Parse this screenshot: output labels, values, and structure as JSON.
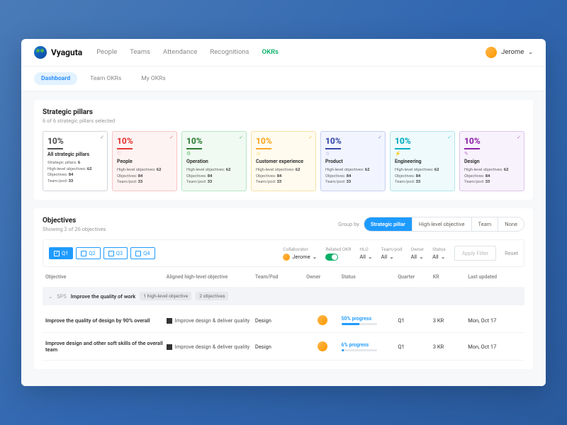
{
  "brand": "Vyaguta",
  "nav": {
    "people": "People",
    "teams": "Teams",
    "attendance": "Attendance",
    "recognitions": "Recognitions",
    "okrs": "OKRs"
  },
  "user": {
    "name": "Jerome"
  },
  "subnav": {
    "dashboard": "Dashboard",
    "team": "Team OKRs",
    "my": "My OKRs"
  },
  "pillars": {
    "title": "Strategic pillars",
    "sub": "6 of 6 strategic pillars selected",
    "stat_labels": {
      "sp": "Strategic pillars:",
      "hlo": "High-level objectives:",
      "obj": "Objectives:",
      "team": "Team/pod:"
    },
    "all": {
      "pct": "10%",
      "name": "All strategic pillars",
      "sp": "6",
      "hlo": "62",
      "obj": "84",
      "team": "33"
    },
    "items": [
      {
        "pct": "10%",
        "name": "People",
        "hlo": "62",
        "obj": "84",
        "team": "33",
        "cls": "p-people",
        "ico": "♡"
      },
      {
        "pct": "10%",
        "name": "Operation",
        "hlo": "62",
        "obj": "84",
        "team": "33",
        "cls": "p-op",
        "ico": "⚙"
      },
      {
        "pct": "10%",
        "name": "Customer experience",
        "hlo": "62",
        "obj": "84",
        "team": "33",
        "cls": "p-cx",
        "ico": "☺"
      },
      {
        "pct": "10%",
        "name": "Product",
        "hlo": "62",
        "obj": "84",
        "team": "33",
        "cls": "p-prod",
        "ico": "☆"
      },
      {
        "pct": "10%",
        "name": "Engineering",
        "hlo": "62",
        "obj": "84",
        "team": "33",
        "cls": "p-eng",
        "ico": "⚡"
      },
      {
        "pct": "10%",
        "name": "Design",
        "hlo": "62",
        "obj": "84",
        "team": "33",
        "cls": "p-des",
        "ico": "✎"
      }
    ]
  },
  "objectives": {
    "title": "Objectives",
    "sub": "Showing 2 of 26 objectives",
    "groupby_label": "Group by",
    "groupby": {
      "sp": "Strategic pillar",
      "hlo": "High-level objective",
      "team": "Team",
      "none": "None"
    },
    "quarters": {
      "q1": "Q1",
      "q2": "Q2",
      "q3": "Q3",
      "q4": "Q4"
    },
    "filters": {
      "collab_lbl": "Collaborator",
      "collab_val": "Jerome",
      "related_lbl": "Related OKR",
      "hlo_lbl": "HLO",
      "hlo_val": "All",
      "team_lbl": "Team/pod",
      "team_val": "All",
      "owner_lbl": "Owner",
      "owner_val": "All",
      "status_lbl": "Status",
      "status_val": "All",
      "apply": "Apply Filter",
      "reset": "Reset"
    },
    "cols": {
      "obj": "Objective",
      "hlo": "Aligned high-level objective",
      "team": "Team/Pod",
      "owner": "Owner",
      "status": "Status",
      "q": "Quarter",
      "kr": "KR",
      "upd": "Last updated"
    },
    "group": {
      "sp": "SP5",
      "title": "Improve the quality of work",
      "tag1": "1 high-level objective",
      "tag2": "2 objectives"
    },
    "rows": [
      {
        "title": "Improve the quality of design by 90% overall",
        "hlo": "Improve design & deliver quality",
        "team": "Design",
        "prog_txt": "50% progress",
        "prog": 50,
        "q": "Q1",
        "kr": "3 KR",
        "upd": "Mon, Oct 17"
      },
      {
        "title": "Improve design and other soft skills of the overall team",
        "hlo": "Improve design & deliver quality",
        "team": "Design",
        "prog_txt": "6% progress",
        "prog": 6,
        "q": "Q1",
        "kr": "3 KR",
        "upd": "Mon, Oct 17"
      }
    ]
  }
}
